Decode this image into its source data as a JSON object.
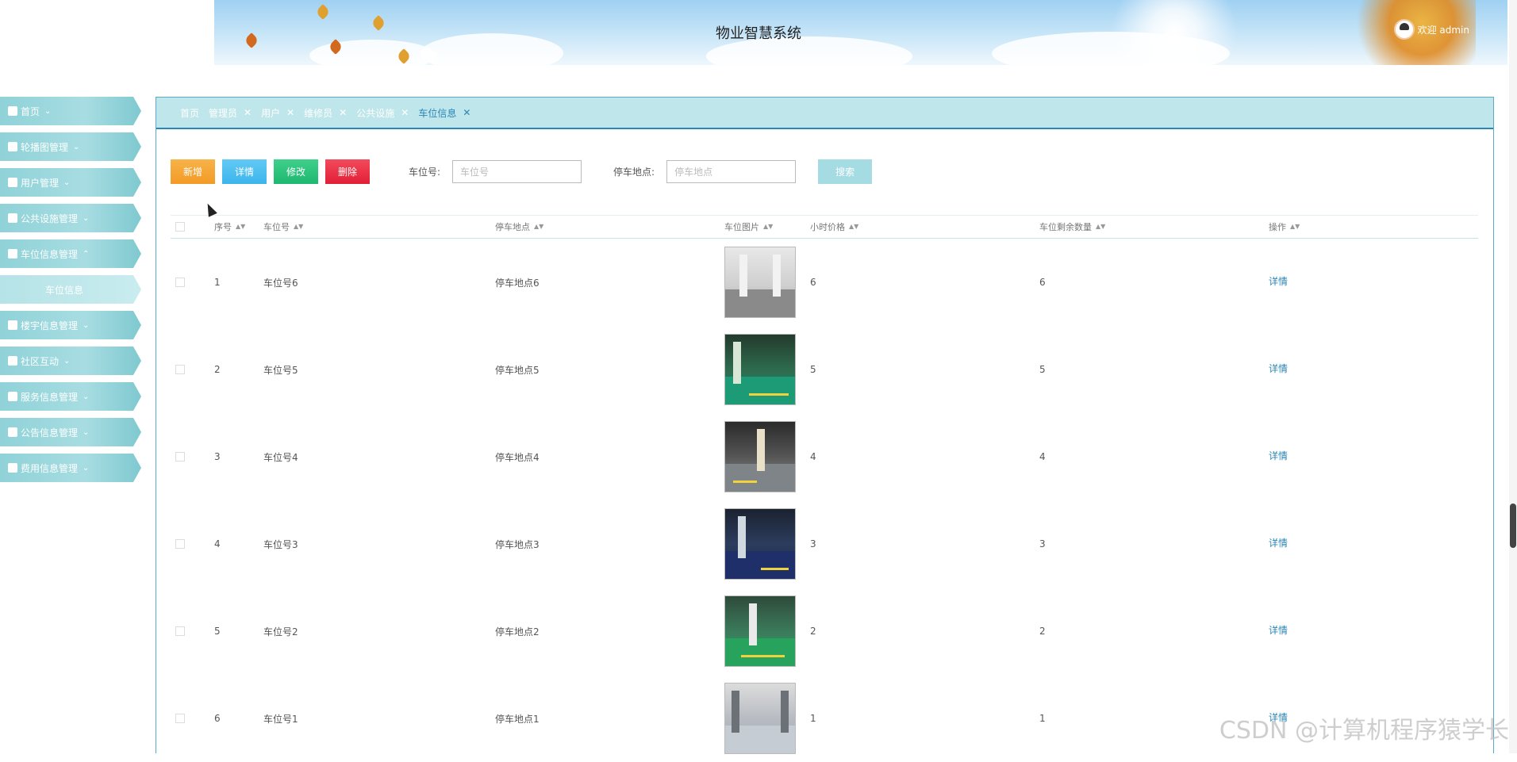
{
  "header": {
    "title": "物业智慧系统",
    "welcome": "欢迎 admin"
  },
  "sidebar": {
    "items": [
      {
        "label": "首页",
        "expanded": false
      },
      {
        "label": "轮播图管理",
        "expanded": false
      },
      {
        "label": "用户管理",
        "expanded": false
      },
      {
        "label": "公共设施管理",
        "expanded": false
      },
      {
        "label": "车位信息管理",
        "expanded": true
      },
      {
        "label": "楼宇信息管理",
        "expanded": false
      },
      {
        "label": "社区互动",
        "expanded": false
      },
      {
        "label": "服务信息管理",
        "expanded": false
      },
      {
        "label": "公告信息管理",
        "expanded": false
      },
      {
        "label": "费用信息管理",
        "expanded": false
      }
    ],
    "sub_item": "车位信息"
  },
  "tabs": [
    {
      "label": "首页",
      "closable": false
    },
    {
      "label": "管理员",
      "closable": true
    },
    {
      "label": "用户",
      "closable": true
    },
    {
      "label": "维修员",
      "closable": true
    },
    {
      "label": "公共设施",
      "closable": true
    },
    {
      "label": "车位信息",
      "closable": true,
      "active": true
    }
  ],
  "toolbar": {
    "add_label": "新增",
    "detail_label": "详情",
    "edit_label": "修改",
    "delete_label": "删除",
    "search_label": "搜索",
    "space_no_label": "车位号:",
    "space_no_placeholder": "车位号",
    "location_label": "停车地点:",
    "location_placeholder": "停车地点"
  },
  "table": {
    "columns": [
      "序号",
      "车位号",
      "停车地点",
      "车位图片",
      "小时价格",
      "车位剩余数量",
      "操作"
    ],
    "action_label": "详情",
    "rows": [
      {
        "index": "1",
        "space_no": "车位号6",
        "location": "停车地点6",
        "price": "6",
        "remaining": "6"
      },
      {
        "index": "2",
        "space_no": "车位号5",
        "location": "停车地点5",
        "price": "5",
        "remaining": "5"
      },
      {
        "index": "3",
        "space_no": "车位号4",
        "location": "停车地点4",
        "price": "4",
        "remaining": "4"
      },
      {
        "index": "4",
        "space_no": "车位号3",
        "location": "停车地点3",
        "price": "3",
        "remaining": "3"
      },
      {
        "index": "5",
        "space_no": "车位号2",
        "location": "停车地点2",
        "price": "2",
        "remaining": "2"
      },
      {
        "index": "6",
        "space_no": "车位号1",
        "location": "停车地点1",
        "price": "1",
        "remaining": "1"
      }
    ]
  },
  "watermark": "CSDN @计算机程序猿学长",
  "colors": {
    "accent": "#2a86b7",
    "sidebar": "#8fd2d8",
    "tab_bar": "#bfe6ea",
    "add": "#f39a26",
    "detail": "#3cb5ec",
    "edit": "#1eb86f",
    "delete": "#e21f36",
    "search": "#a5dbe2"
  }
}
